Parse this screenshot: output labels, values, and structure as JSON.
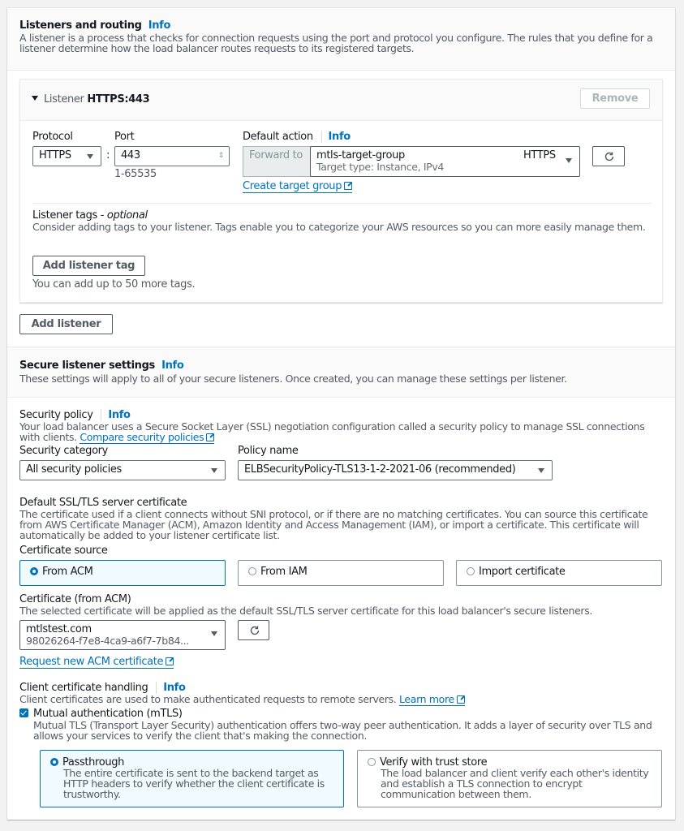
{
  "listeners_routing": {
    "title": "Listeners and routing",
    "info": "Info",
    "description": "A listener is a process that checks for connection requests using the port and protocol you configure. The rules that you define for a listener determine how the load balancer routes requests to its registered targets."
  },
  "listener": {
    "label": "Listener",
    "name": "HTTPS:443",
    "remove_label": "Remove",
    "protocol_label": "Protocol",
    "protocol_value": "HTTPS",
    "port_label": "Port",
    "port_value": "443",
    "port_range": "1-65535",
    "default_action_label": "Default action",
    "default_action_info": "Info",
    "forward_to_label": "Forward to",
    "target_group_name": "mtls-target-group",
    "target_group_detail": "Target type: Instance, IPv4",
    "target_group_protocol": "HTTPS",
    "create_target_group_link": "Create target group",
    "tags_label": "Listener tags",
    "tags_optional": "optional",
    "tags_description": "Consider adding tags to your listener. Tags enable you to categorize your AWS resources so you can more easily manage them.",
    "add_tag_label": "Add listener tag",
    "tags_hint": "You can add up to 50 more tags."
  },
  "add_listener_label": "Add listener",
  "secure_settings": {
    "title": "Secure listener settings",
    "info": "Info",
    "description": "These settings will apply to all of your secure listeners. Once created, you can manage these settings per listener."
  },
  "security_policy": {
    "title": "Security policy",
    "info": "Info",
    "description": "Your load balancer uses a Secure Socket Layer (SSL) negotiation configuration called a security policy to manage SSL connections with clients.",
    "compare_link": "Compare security policies",
    "category_label": "Security category",
    "category_value": "All security policies",
    "policy_label": "Policy name",
    "policy_value": "ELBSecurityPolicy-TLS13-1-2-2021-06 (recommended)"
  },
  "default_cert": {
    "title": "Default SSL/TLS server certificate",
    "description": "The certificate used if a client connects without SNI protocol, or if there are no matching certificates. You can source this certificate from AWS Certificate Manager (ACM), Amazon Identity and Access Management (IAM), or import a certificate. This certificate will automatically be added to your listener certificate list.",
    "source_label": "Certificate source",
    "sources": [
      {
        "label": "From ACM",
        "selected": true
      },
      {
        "label": "From IAM",
        "selected": false
      },
      {
        "label": "Import certificate",
        "selected": false
      }
    ],
    "acm_label": "Certificate (from ACM)",
    "acm_description": "The selected certificate will be applied as the default SSL/TLS server certificate for this load balancer's secure listeners.",
    "cert_name": "mtlstest.com",
    "cert_id": "98026264-f7e8-4ca9-a6f7-7b84...",
    "request_link": "Request new ACM certificate"
  },
  "client_cert": {
    "title": "Client certificate handling",
    "info": "Info",
    "description": "Client certificates are used to make authenticated requests to remote servers.",
    "learn_more": "Learn more",
    "mtls_label": "Mutual authentication (mTLS)",
    "mtls_checked": true,
    "mtls_description": "Mutual TLS (Transport Layer Security) authentication offers two-way peer authentication. It adds a layer of security over TLS and allows your services to verify the client that's making the connection.",
    "modes": [
      {
        "label": "Passthrough",
        "description": "The entire certificate is sent to the backend target as HTTP headers to verify whether the client certificate is trustworthy.",
        "selected": true
      },
      {
        "label": "Verify with trust store",
        "description": "The load balancer and client verify each other's identity and establish a TLS connection to encrypt communication between them.",
        "selected": false
      }
    ]
  },
  "colors": {
    "link": "#0073bb",
    "selected_tile_bg": "#f1faff",
    "header_bg": "#fafafa",
    "page_bg": "#f2f2f2"
  }
}
